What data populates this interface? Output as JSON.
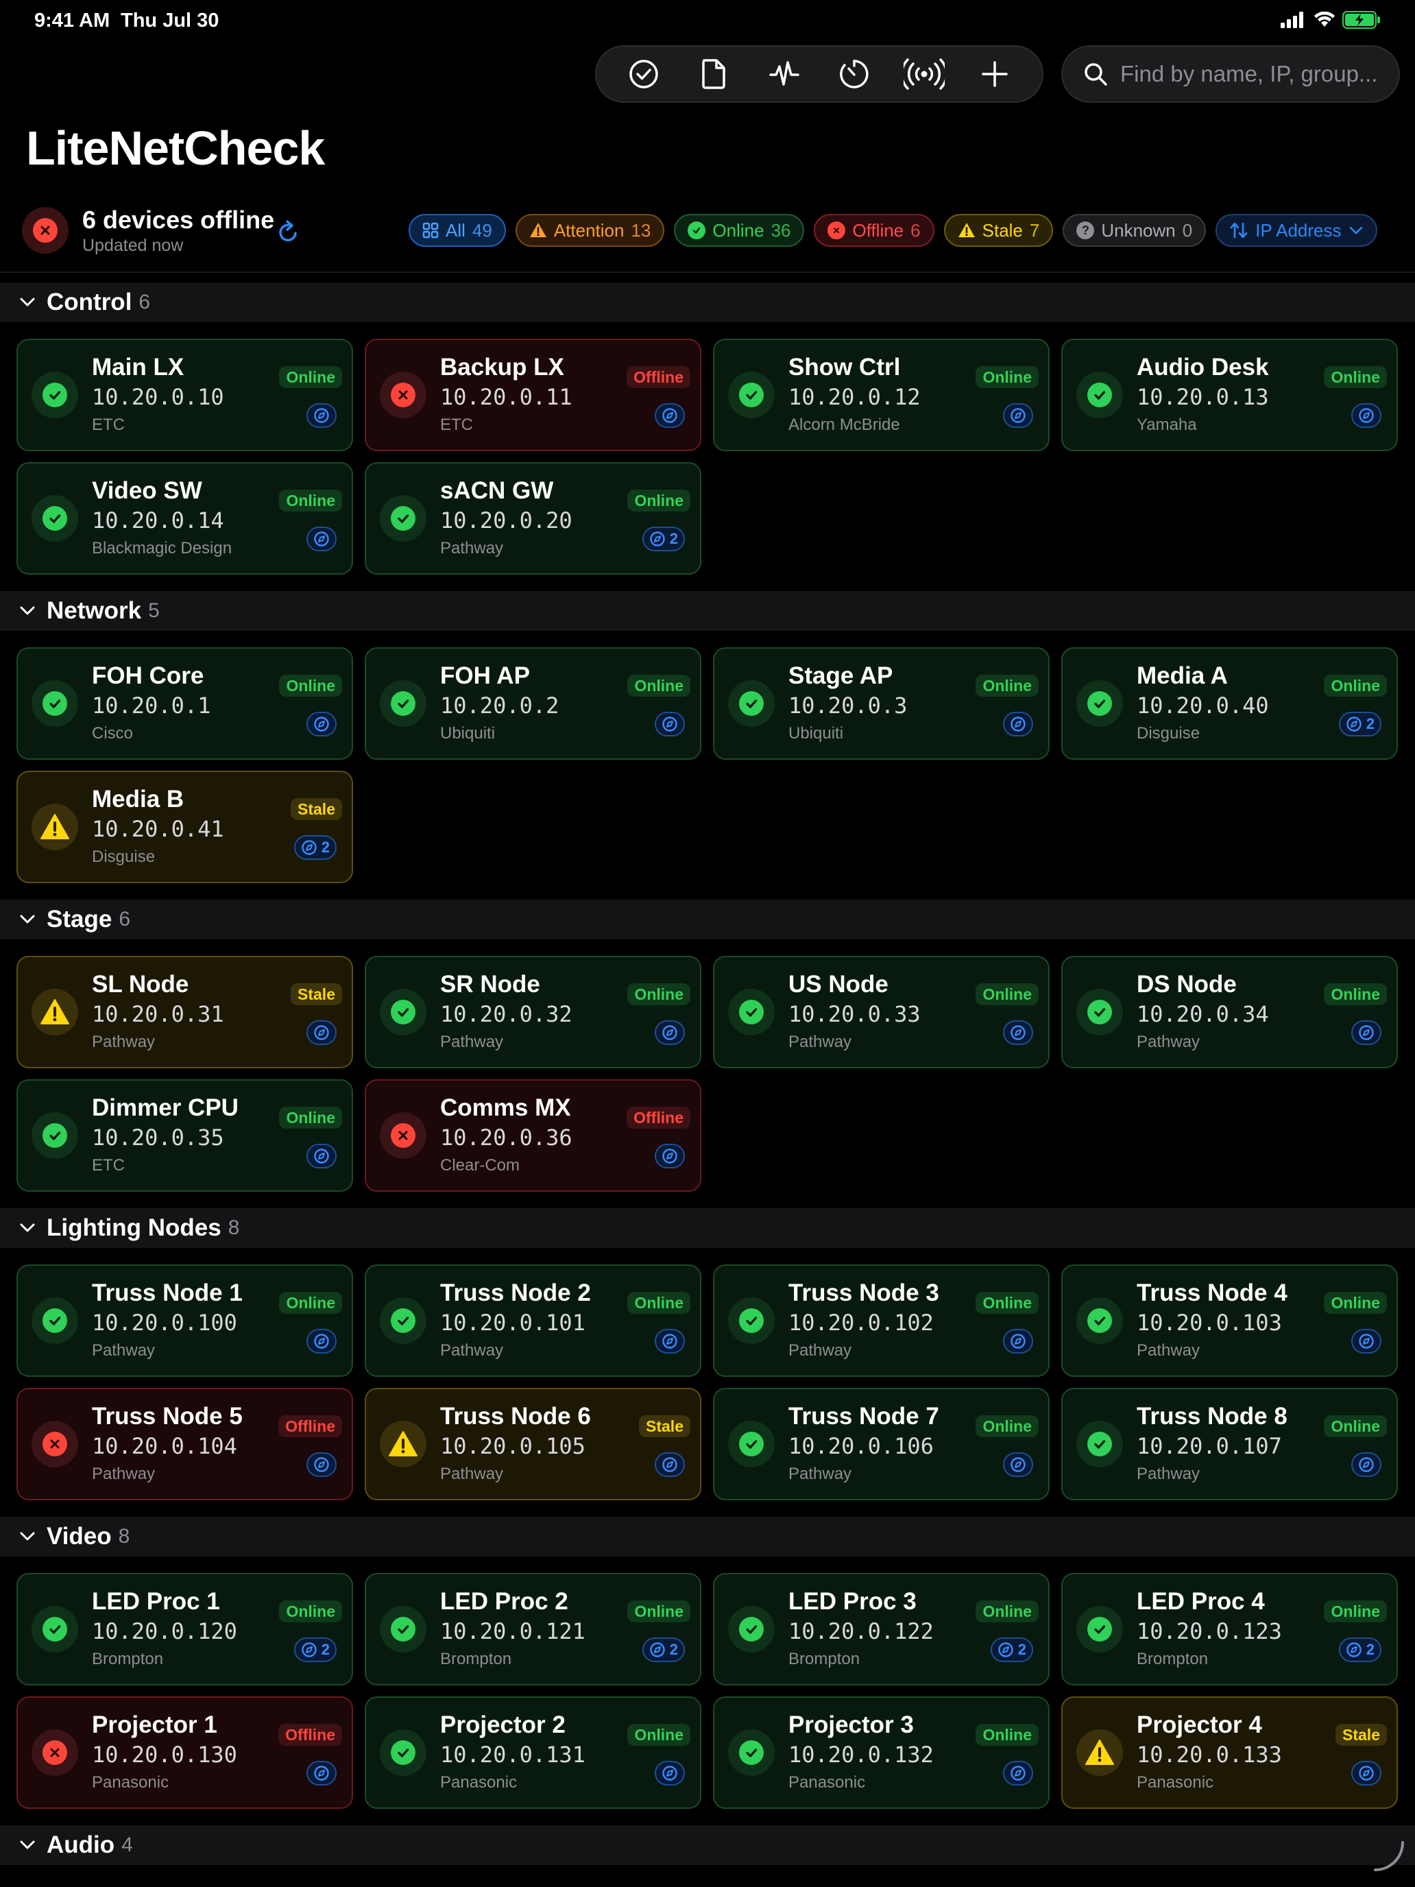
{
  "status_bar": {
    "time": "9:41 AM",
    "date": "Thu Jul 30"
  },
  "toolbar": {
    "buttons": [
      {
        "name": "check-circle-icon"
      },
      {
        "name": "document-icon"
      },
      {
        "name": "activity-icon"
      },
      {
        "name": "timer-icon"
      },
      {
        "name": "broadcast-icon"
      },
      {
        "name": "plus-icon"
      }
    ]
  },
  "search": {
    "placeholder": "Find by name, IP, group..."
  },
  "app": {
    "title": "LiteNetCheck"
  },
  "summary": {
    "title": "6 devices offline",
    "subtitle": "Updated now"
  },
  "filters": {
    "all": {
      "label": "All",
      "count": "49"
    },
    "attention": {
      "label": "Attention",
      "count": "13"
    },
    "online": {
      "label": "Online",
      "count": "36"
    },
    "offline": {
      "label": "Offline",
      "count": "6"
    },
    "stale": {
      "label": "Stale",
      "count": "7"
    },
    "unknown": {
      "label": "Unknown",
      "count": "0"
    },
    "sort": {
      "label": "IP Address"
    }
  },
  "colors": {
    "online": "#30d158",
    "offline": "#ff453a",
    "stale": "#ffd60a",
    "accent": "#2f86f6",
    "background": "#000000"
  },
  "sections": [
    {
      "name": "Control",
      "count": "6",
      "devices": [
        {
          "name": "Main LX",
          "ip": "10.20.0.10",
          "vendor": "ETC",
          "status": "online",
          "badge": "Online",
          "links": ""
        },
        {
          "name": "Backup LX",
          "ip": "10.20.0.11",
          "vendor": "ETC",
          "status": "offline",
          "badge": "Offline",
          "links": ""
        },
        {
          "name": "Show Ctrl",
          "ip": "10.20.0.12",
          "vendor": "Alcorn McBride",
          "status": "online",
          "badge": "Online",
          "links": ""
        },
        {
          "name": "Audio Desk",
          "ip": "10.20.0.13",
          "vendor": "Yamaha",
          "status": "online",
          "badge": "Online",
          "links": ""
        },
        {
          "name": "Video SW",
          "ip": "10.20.0.14",
          "vendor": "Blackmagic Design",
          "status": "online",
          "badge": "Online",
          "links": ""
        },
        {
          "name": "sACN GW",
          "ip": "10.20.0.20",
          "vendor": "Pathway",
          "status": "online",
          "badge": "Online",
          "links": "2"
        }
      ]
    },
    {
      "name": "Network",
      "count": "5",
      "devices": [
        {
          "name": "FOH Core",
          "ip": "10.20.0.1",
          "vendor": "Cisco",
          "status": "online",
          "badge": "Online",
          "links": ""
        },
        {
          "name": "FOH AP",
          "ip": "10.20.0.2",
          "vendor": "Ubiquiti",
          "status": "online",
          "badge": "Online",
          "links": ""
        },
        {
          "name": "Stage AP",
          "ip": "10.20.0.3",
          "vendor": "Ubiquiti",
          "status": "online",
          "badge": "Online",
          "links": ""
        },
        {
          "name": "Media A",
          "ip": "10.20.0.40",
          "vendor": "Disguise",
          "status": "online",
          "badge": "Online",
          "links": "2"
        },
        {
          "name": "Media B",
          "ip": "10.20.0.41",
          "vendor": "Disguise",
          "status": "stale",
          "badge": "Stale",
          "links": "2"
        }
      ]
    },
    {
      "name": "Stage",
      "count": "6",
      "devices": [
        {
          "name": "SL Node",
          "ip": "10.20.0.31",
          "vendor": "Pathway",
          "status": "stale",
          "badge": "Stale",
          "links": ""
        },
        {
          "name": "SR Node",
          "ip": "10.20.0.32",
          "vendor": "Pathway",
          "status": "online",
          "badge": "Online",
          "links": ""
        },
        {
          "name": "US Node",
          "ip": "10.20.0.33",
          "vendor": "Pathway",
          "status": "online",
          "badge": "Online",
          "links": ""
        },
        {
          "name": "DS Node",
          "ip": "10.20.0.34",
          "vendor": "Pathway",
          "status": "online",
          "badge": "Online",
          "links": ""
        },
        {
          "name": "Dimmer CPU",
          "ip": "10.20.0.35",
          "vendor": "ETC",
          "status": "online",
          "badge": "Online",
          "links": ""
        },
        {
          "name": "Comms MX",
          "ip": "10.20.0.36",
          "vendor": "Clear-Com",
          "status": "offline",
          "badge": "Offline",
          "links": ""
        }
      ]
    },
    {
      "name": "Lighting Nodes",
      "count": "8",
      "devices": [
        {
          "name": "Truss Node 1",
          "ip": "10.20.0.100",
          "vendor": "Pathway",
          "status": "online",
          "badge": "Online",
          "links": ""
        },
        {
          "name": "Truss Node 2",
          "ip": "10.20.0.101",
          "vendor": "Pathway",
          "status": "online",
          "badge": "Online",
          "links": ""
        },
        {
          "name": "Truss Node 3",
          "ip": "10.20.0.102",
          "vendor": "Pathway",
          "status": "online",
          "badge": "Online",
          "links": ""
        },
        {
          "name": "Truss Node 4",
          "ip": "10.20.0.103",
          "vendor": "Pathway",
          "status": "online",
          "badge": "Online",
          "links": ""
        },
        {
          "name": "Truss Node 5",
          "ip": "10.20.0.104",
          "vendor": "Pathway",
          "status": "offline",
          "badge": "Offline",
          "links": ""
        },
        {
          "name": "Truss Node 6",
          "ip": "10.20.0.105",
          "vendor": "Pathway",
          "status": "stale",
          "badge": "Stale",
          "links": ""
        },
        {
          "name": "Truss Node 7",
          "ip": "10.20.0.106",
          "vendor": "Pathway",
          "status": "online",
          "badge": "Online",
          "links": ""
        },
        {
          "name": "Truss Node 8",
          "ip": "10.20.0.107",
          "vendor": "Pathway",
          "status": "online",
          "badge": "Online",
          "links": ""
        }
      ]
    },
    {
      "name": "Video",
      "count": "8",
      "devices": [
        {
          "name": "LED Proc 1",
          "ip": "10.20.0.120",
          "vendor": "Brompton",
          "status": "online",
          "badge": "Online",
          "links": "2"
        },
        {
          "name": "LED Proc 2",
          "ip": "10.20.0.121",
          "vendor": "Brompton",
          "status": "online",
          "badge": "Online",
          "links": "2"
        },
        {
          "name": "LED Proc 3",
          "ip": "10.20.0.122",
          "vendor": "Brompton",
          "status": "online",
          "badge": "Online",
          "links": "2"
        },
        {
          "name": "LED Proc 4",
          "ip": "10.20.0.123",
          "vendor": "Brompton",
          "status": "online",
          "badge": "Online",
          "links": "2"
        },
        {
          "name": "Projector 1",
          "ip": "10.20.0.130",
          "vendor": "Panasonic",
          "status": "offline",
          "badge": "Offline",
          "links": ""
        },
        {
          "name": "Projector 2",
          "ip": "10.20.0.131",
          "vendor": "Panasonic",
          "status": "online",
          "badge": "Online",
          "links": ""
        },
        {
          "name": "Projector 3",
          "ip": "10.20.0.132",
          "vendor": "Panasonic",
          "status": "online",
          "badge": "Online",
          "links": ""
        },
        {
          "name": "Projector 4",
          "ip": "10.20.0.133",
          "vendor": "Panasonic",
          "status": "stale",
          "badge": "Stale",
          "links": ""
        }
      ]
    },
    {
      "name": "Audio",
      "count": "4",
      "devices": []
    }
  ]
}
